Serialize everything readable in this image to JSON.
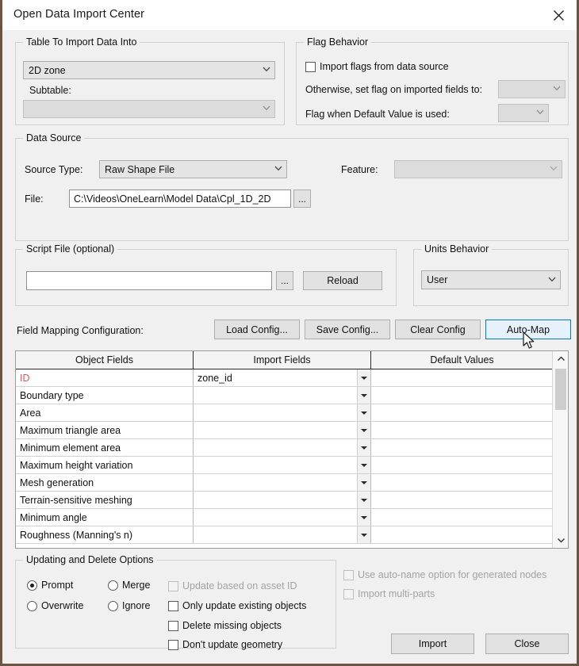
{
  "window": {
    "title": "Open Data Import Center",
    "close_icon": "close-icon"
  },
  "table_group": {
    "legend": "Table To Import Data Into",
    "table_combo_value": "2D zone",
    "subtable_label": "Subtable:",
    "subtable_combo_value": ""
  },
  "flag_group": {
    "legend": "Flag Behavior",
    "import_flags_label": "Import flags from data source",
    "import_flags_checked": false,
    "otherwise_label": "Otherwise, set flag on imported fields to:",
    "otherwise_value": "",
    "default_value_label": "Flag when Default Value is used:",
    "default_value_value": ""
  },
  "data_source": {
    "legend": "Data Source",
    "source_type_label": "Source Type:",
    "source_type_value": "Raw Shape File",
    "feature_label": "Feature:",
    "feature_value": "",
    "file_label": "File:",
    "file_value": "C:\\Videos\\OneLearn\\Model Data\\Cpl_1D_2D",
    "file_browse_label": "..."
  },
  "script_group": {
    "legend": "Script File (optional)",
    "script_value": "",
    "script_placeholder": "",
    "browse_label": "...",
    "reload_label": "Reload"
  },
  "units_group": {
    "legend": "Units Behavior",
    "units_value": "User"
  },
  "field_mapping": {
    "label": "Field Mapping Configuration:",
    "load_config_label": "Load Config...",
    "save_config_label": "Save Config...",
    "clear_config_label": "Clear Config",
    "auto_map_label": "Auto-Map"
  },
  "grid": {
    "headers": [
      "Object Fields",
      "Import Fields",
      "Default Values"
    ],
    "rows": [
      {
        "object_field": "ID",
        "import_field": "zone_id",
        "default_value": "",
        "required": true
      },
      {
        "object_field": "Boundary type",
        "import_field": "",
        "default_value": "",
        "required": false
      },
      {
        "object_field": "Area",
        "import_field": "",
        "default_value": "",
        "required": false
      },
      {
        "object_field": "Maximum triangle area",
        "import_field": "",
        "default_value": "",
        "required": false
      },
      {
        "object_field": "Minimum element area",
        "import_field": "",
        "default_value": "",
        "required": false
      },
      {
        "object_field": "Maximum height variation",
        "import_field": "",
        "default_value": "",
        "required": false
      },
      {
        "object_field": "Mesh generation",
        "import_field": "",
        "default_value": "",
        "required": false
      },
      {
        "object_field": "Terrain-sensitive meshing",
        "import_field": "",
        "default_value": "",
        "required": false
      },
      {
        "object_field": "Minimum angle",
        "import_field": "",
        "default_value": "",
        "required": false
      },
      {
        "object_field": "Roughness (Manning's n)",
        "import_field": "",
        "default_value": "",
        "required": false
      }
    ],
    "scroll_up_icon": "chevron-up-icon",
    "scroll_down_icon": "chevron-down-icon"
  },
  "update_group": {
    "legend": "Updating and Delete Options",
    "radios": [
      {
        "label": "Prompt",
        "checked": true
      },
      {
        "label": "Overwrite",
        "checked": false
      },
      {
        "label": "Merge",
        "checked": false
      },
      {
        "label": "Ignore",
        "checked": false
      }
    ],
    "checks": [
      {
        "label": "Update based on asset ID",
        "checked": false,
        "disabled": true
      },
      {
        "label": "Only update existing objects",
        "checked": false,
        "disabled": false
      },
      {
        "label": "Delete missing objects",
        "checked": false,
        "disabled": false
      },
      {
        "label": "Don't update geometry",
        "checked": false,
        "disabled": false
      }
    ]
  },
  "right_options": {
    "auto_name_label": "Use auto-name option for generated nodes",
    "auto_name_checked": false,
    "auto_name_disabled": true,
    "multi_parts_label": "Import multi-parts",
    "multi_parts_checked": false,
    "multi_parts_disabled": true
  },
  "actions": {
    "import_label": "Import",
    "close_label": "Close"
  },
  "colors": {
    "window_bg": "#f0f0f0",
    "accent": "#0078d7",
    "required_field": "#d05a5a",
    "window_border": "#6b5540"
  }
}
